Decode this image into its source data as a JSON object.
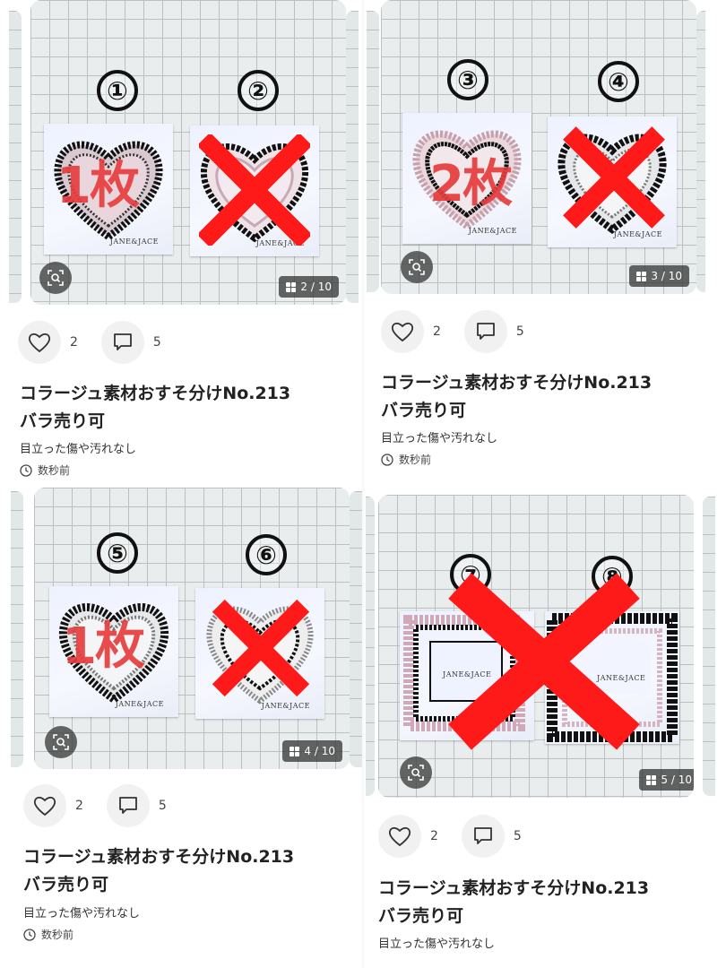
{
  "cards": [
    {
      "counter": "2 / 10",
      "likes": "2",
      "comments": "5",
      "title_line1": "コラージュ素材おすそ分けNo.213",
      "title_line2": "バラ売り可",
      "condition": "目立った傷や汚れなし",
      "time": "数秒前",
      "labels": [
        "①",
        "②"
      ],
      "overlay": "1枚"
    },
    {
      "counter": "3 / 10",
      "likes": "2",
      "comments": "5",
      "title_line1": "コラージュ素材おすそ分けNo.213",
      "title_line2": "バラ売り可",
      "condition": "目立った傷や汚れなし",
      "time": "数秒前",
      "labels": [
        "③",
        "④"
      ],
      "overlay": "2枚"
    },
    {
      "counter": "4 / 10",
      "likes": "2",
      "comments": "5",
      "title_line1": "コラージュ素材おすそ分けNo.213",
      "title_line2": "バラ売り可",
      "condition": "目立った傷や汚れなし",
      "time": "数秒前",
      "labels": [
        "⑤",
        "⑥"
      ],
      "overlay": "1枚"
    },
    {
      "counter": "5 / 10",
      "likes": "2",
      "comments": "5",
      "title_line1": "コラージュ素材おすそ分けNo.213",
      "title_line2": "バラ売り可",
      "condition": "目立った傷や汚れなし",
      "labels": [
        "⑦",
        "⑧"
      ]
    }
  ],
  "sticker_brand": "JANE&JACE",
  "icons": [
    "zoom-scan-icon",
    "images-grid-icon",
    "heart-icon",
    "comment-icon",
    "clock-icon"
  ],
  "colors": {
    "cross": "#ff1a1a",
    "overlay_text": "#e63c3c",
    "grid_line": "#b9c1c2"
  }
}
